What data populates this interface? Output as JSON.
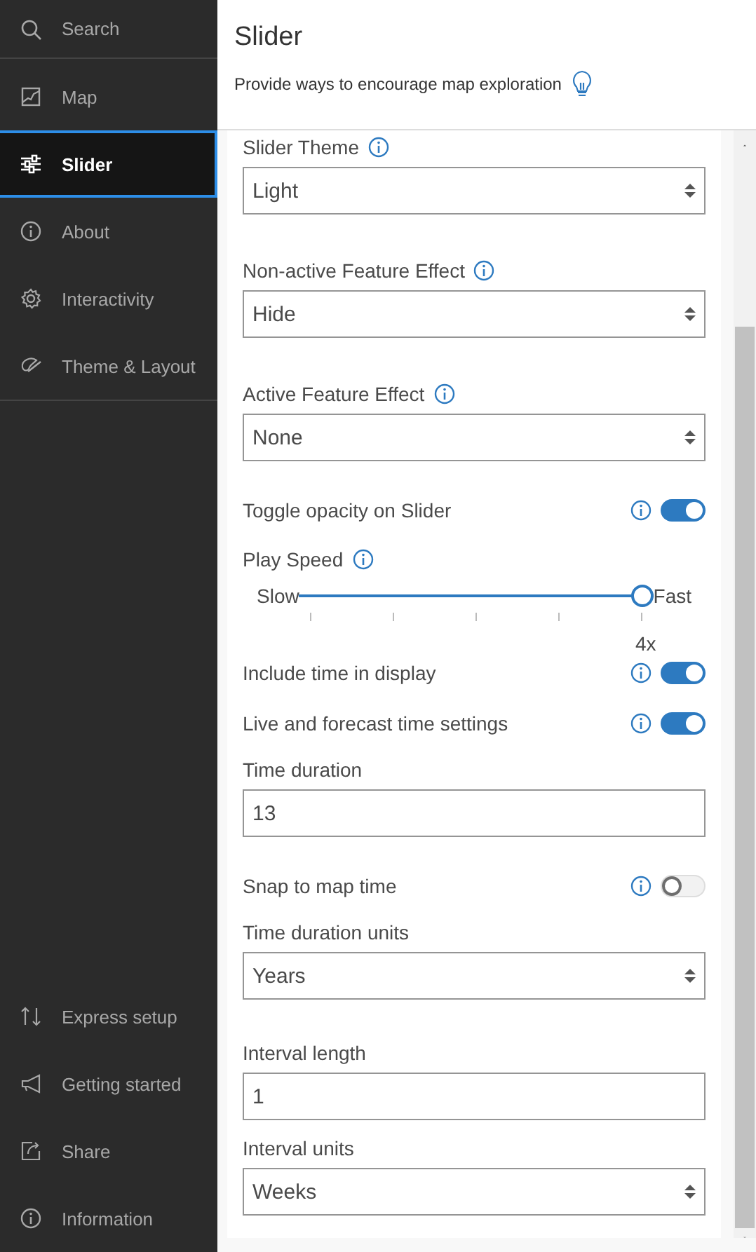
{
  "sidebar": {
    "items": [
      {
        "label": "Search",
        "selected": false
      },
      {
        "label": "Map",
        "selected": false
      },
      {
        "label": "Slider",
        "selected": true
      },
      {
        "label": "About",
        "selected": false
      },
      {
        "label": "Interactivity",
        "selected": false
      },
      {
        "label": "Theme & Layout",
        "selected": false
      }
    ],
    "footer_items": [
      {
        "label": "Express setup"
      },
      {
        "label": "Getting started"
      },
      {
        "label": "Share"
      },
      {
        "label": "Information"
      }
    ]
  },
  "header": {
    "title": "Slider",
    "subtitle": "Provide ways to encourage map exploration"
  },
  "settings": [
    {
      "kind": "select",
      "label": "Slider Theme",
      "info": true,
      "value": "Light"
    },
    {
      "kind": "select",
      "label": "Non-active Feature Effect",
      "info": true,
      "value": "Hide"
    },
    {
      "kind": "select",
      "label": "Active Feature Effect",
      "info": true,
      "value": "None"
    },
    {
      "kind": "toggle",
      "label": "Toggle opacity on Slider",
      "info": true,
      "on": true
    },
    {
      "kind": "slider",
      "label": "Play Speed",
      "info": true,
      "min_label": "Slow",
      "max_label": "Fast",
      "level": 1,
      "tick_label": "4x"
    },
    {
      "kind": "toggle",
      "label": "Include time in display",
      "info": true,
      "on": true
    },
    {
      "kind": "toggle",
      "label": "Live and forecast time settings",
      "info": true,
      "on": true
    },
    {
      "kind": "input",
      "label": "Time duration",
      "info": false,
      "value": "13"
    },
    {
      "kind": "toggle",
      "label": "Snap to map time",
      "info": true,
      "on": false
    },
    {
      "kind": "select",
      "label": "Time duration units",
      "info": false,
      "value": "Years"
    },
    {
      "kind": "input",
      "label": "Interval length",
      "info": false,
      "value": "1"
    },
    {
      "kind": "select",
      "label": "Interval units",
      "info": false,
      "value": "Weeks"
    }
  ]
}
